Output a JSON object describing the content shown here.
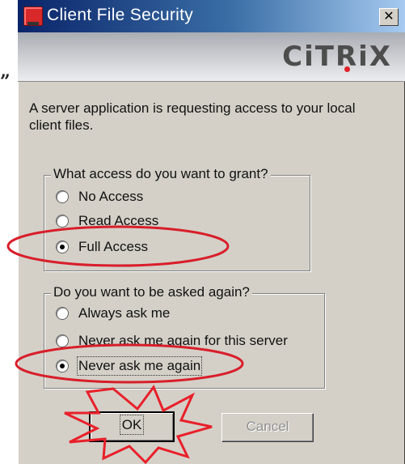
{
  "quote": "”",
  "window": {
    "title": "Client File Security",
    "close_glyph": "✕",
    "brand": "CiTRiX"
  },
  "message": "A server application is requesting access to your local client files.",
  "access_group": {
    "legend": "What access do you want to grant?",
    "options": [
      {
        "label": "No Access",
        "checked": false
      },
      {
        "label": "Read Access",
        "checked": false
      },
      {
        "label": "Full Access",
        "checked": true
      }
    ]
  },
  "ask_group": {
    "legend": "Do you want to be asked again?",
    "options": [
      {
        "label": "Always ask me",
        "checked": false
      },
      {
        "label": "Never ask me again for this server",
        "checked": false
      },
      {
        "label": "Never ask me again",
        "checked": true
      }
    ]
  },
  "buttons": {
    "ok": "OK",
    "cancel": "Cancel"
  },
  "annotations": {
    "highlight_color": "#d81e2a",
    "burst_color": "#e8202a"
  },
  "icons": {
    "title": "app-icon",
    "close": "close-icon",
    "burst": "starburst-annotation-icon"
  }
}
